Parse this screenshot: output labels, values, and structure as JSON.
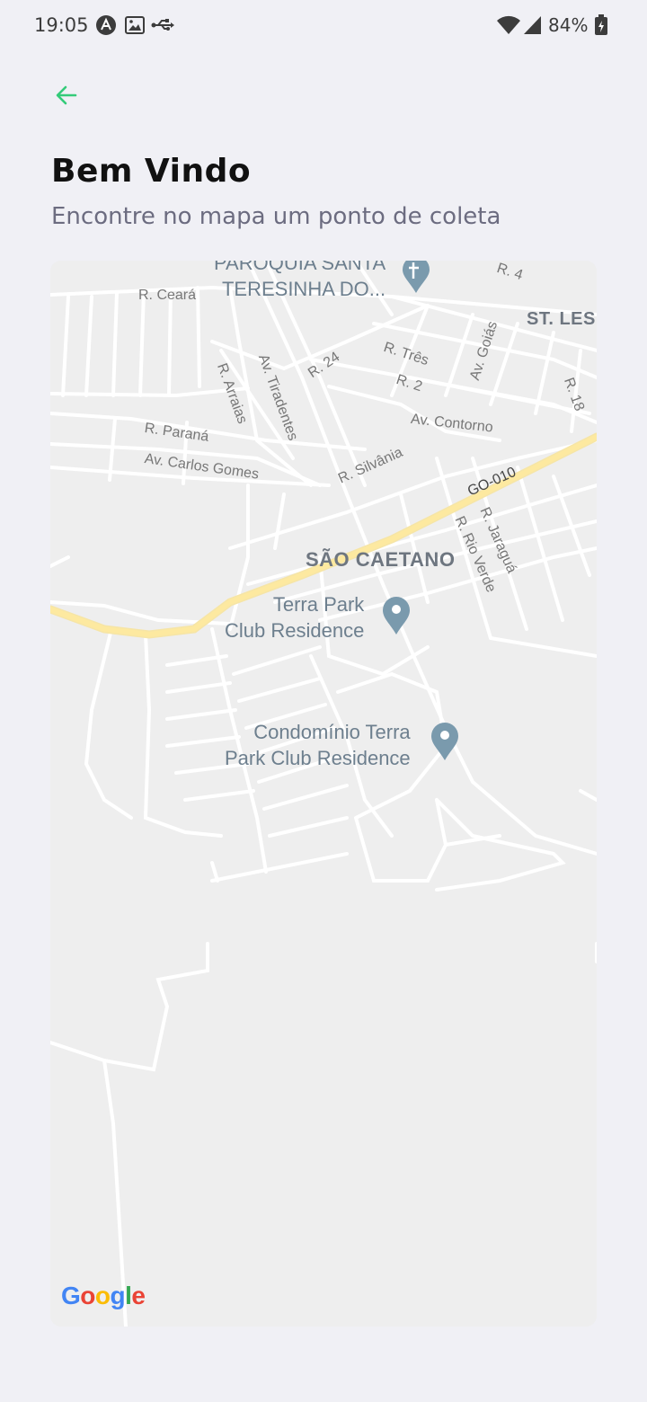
{
  "status_bar": {
    "time": "19:05",
    "battery_percent": "84%",
    "icons": [
      "app-a-icon",
      "image-icon",
      "usb-icon",
      "wifi-icon",
      "signal-icon",
      "battery-icon"
    ]
  },
  "header": {
    "back_icon": "arrow-left-icon",
    "accent_color": "#34cb79",
    "title": "Bem Vindo",
    "subtitle": "Encontre no mapa um ponto de coleta"
  },
  "map": {
    "provider": "Google",
    "district": "SÃO CAETANO",
    "district_2": "ST. LES",
    "pois": [
      {
        "line1": "PARÓQUIA SANTA",
        "line2": "TERESINHA DO..."
      },
      {
        "line1": "Terra Park",
        "line2": "Club Residence"
      },
      {
        "line1": "Condomínio Terra",
        "line2": "Park Club Residence"
      }
    ],
    "streets": {
      "ceara": "R. Ceará",
      "r4": "R. 4",
      "r24": "R. 24",
      "tres": "R. Três",
      "goias": "Av. Goiás",
      "r2": "R. 2",
      "r18": "R. 18",
      "arraias": "R. Arraias",
      "tiradentes": "Av. Tiradentes",
      "contorno": "Av. Contorno",
      "parana": "R. Paraná",
      "carlos_gomes": "Av. Carlos Gomes",
      "silvania": "R. Silvânia",
      "go010": "GO-010",
      "jaragua": "R. Jaraguá",
      "rio_verde": "R. Rio Verde"
    }
  }
}
